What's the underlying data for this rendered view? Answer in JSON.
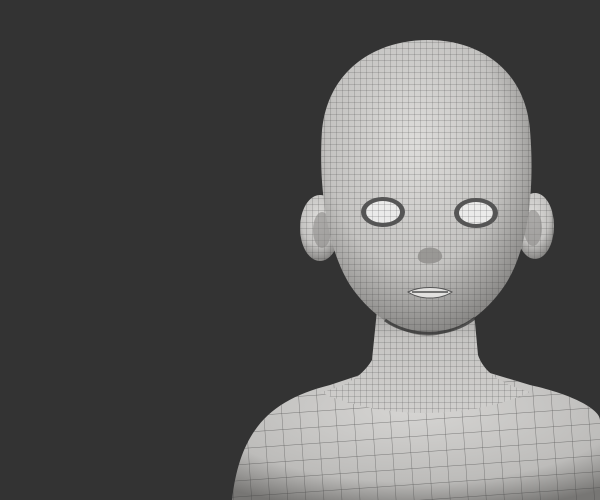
{
  "scene": {
    "background_color": "#333333",
    "mesh_color": "#cdccca",
    "shadow_color": "#6e6d6b",
    "wire_color": "#3c3c3c"
  }
}
